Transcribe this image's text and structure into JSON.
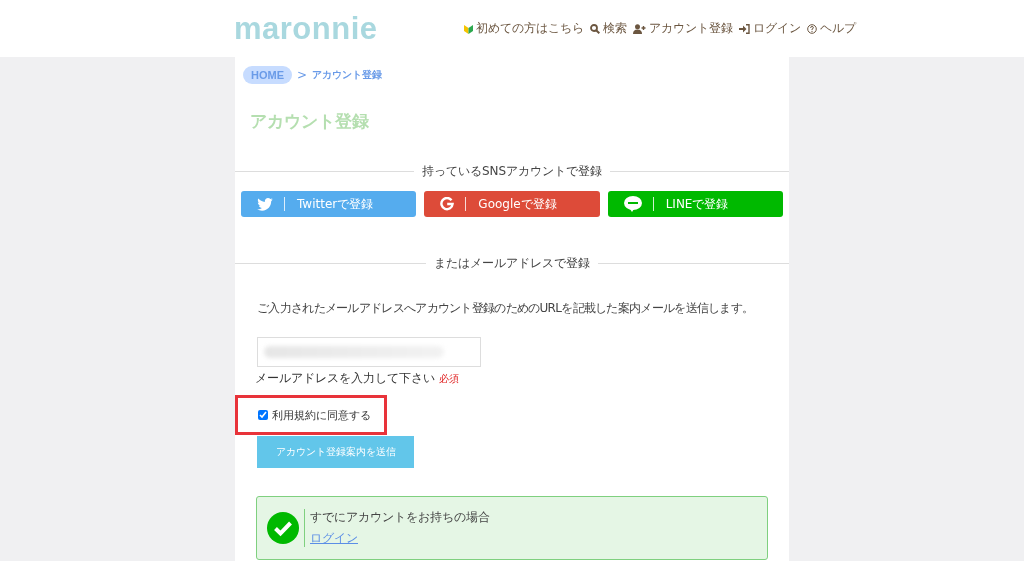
{
  "header": {
    "logo": "maronnie",
    "nav": [
      {
        "kind": "beginner",
        "label": "初めての方はこちら"
      },
      {
        "kind": "search",
        "label": "検索"
      },
      {
        "kind": "signup",
        "label": "アカウント登録"
      },
      {
        "kind": "login",
        "label": "ログイン"
      },
      {
        "kind": "help",
        "label": "ヘルプ"
      }
    ]
  },
  "breadcrumb": {
    "home": "HOME",
    "separator": ">",
    "current": "アカウント登録"
  },
  "page_title": "アカウント登録",
  "sns_section": {
    "heading": "持っているSNSアカウントで登録",
    "buttons": [
      {
        "kind": "twitter",
        "label": "Twitterで登録"
      },
      {
        "kind": "google",
        "label": "Googleで登録"
      },
      {
        "kind": "line",
        "label": "LINEで登録"
      }
    ]
  },
  "email_section": {
    "heading": "またはメールアドレスで登録",
    "description": "ご入力されたメールアドレスへアカウント登録のためのURLを記載した案内メールを送信します。",
    "field_label": "メールアドレスを入力して下さい",
    "required_badge": "必須",
    "terms": {
      "label": "利用規約に同意する",
      "checked": true,
      "highlighted": true
    },
    "submit": "アカウント登録案内を送信"
  },
  "login_notice": {
    "text": "すでにアカウントをお持ちの場合",
    "link": "ログイン"
  }
}
